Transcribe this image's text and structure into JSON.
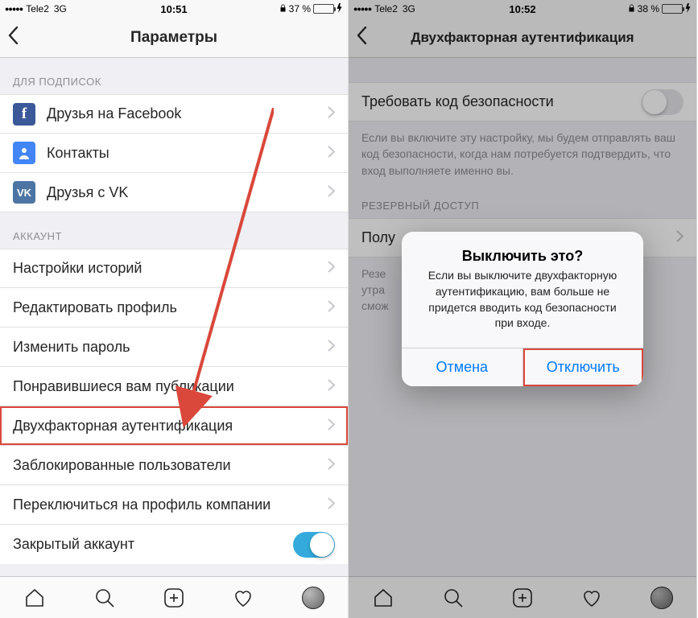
{
  "left": {
    "status": {
      "carrier": "Tele2",
      "network": "3G",
      "time": "10:51",
      "battery_pct": "37 %",
      "battery_fill": 37
    },
    "nav_title": "Параметры",
    "section_subscriptions": "ДЛЯ ПОДПИСОК",
    "rows_subscriptions": [
      {
        "label": "Друзья на Facebook"
      },
      {
        "label": "Контакты"
      },
      {
        "label": "Друзья с VK"
      }
    ],
    "section_account": "АККАУНТ",
    "rows_account": [
      {
        "label": "Настройки историй"
      },
      {
        "label": "Редактировать профиль"
      },
      {
        "label": "Изменить пароль"
      },
      {
        "label": "Понравившиеся вам публикации"
      },
      {
        "label": "Двухфакторная аутентификация",
        "highlight": true
      },
      {
        "label": "Заблокированные пользователи"
      },
      {
        "label": "Переключиться на профиль компании"
      },
      {
        "label": "Закрытый аккаунт",
        "toggle": true
      }
    ]
  },
  "right": {
    "status": {
      "carrier": "Tele2",
      "network": "3G",
      "time": "10:52",
      "battery_pct": "38 %",
      "battery_fill": 38
    },
    "nav_title": "Двухфакторная аутентификация",
    "row_require": "Требовать код безопасности",
    "help_require": "Если вы включите эту настройку, мы будем отправлять ваш код безопасности, когда нам потребуется подтвердить, что вход выполняете именно вы.",
    "section_backup": "РЕЗЕРВНЫЙ ДОСТУП",
    "row_backup": "Полу",
    "help_backup_1": "Резе",
    "help_backup_2": "утра",
    "help_backup_3": "смож",
    "alert": {
      "title": "Выключить это?",
      "message": "Если вы выключите двухфакторную аутентификацию, вам больше не придется вводить код безопасности при входе.",
      "cancel": "Отмена",
      "confirm": "Отключить"
    }
  }
}
